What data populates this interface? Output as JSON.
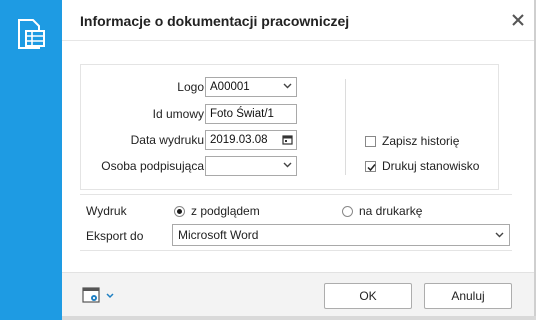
{
  "dialog": {
    "title": "Informacje o dokumentacji pracowniczej"
  },
  "colors": {
    "sidebar": "#1e9be3",
    "accent": "#1e9be3"
  },
  "icons": {
    "app": "spreadsheet-document-icon",
    "close": "close-icon",
    "settings": "window-settings-icon"
  },
  "form": {
    "logo": {
      "label": "Logo",
      "value": "A00001"
    },
    "contract": {
      "label": "Id umowy",
      "value": "Foto Świat/1"
    },
    "print_date": {
      "label": "Data wydruku",
      "value": "2019.03.08"
    },
    "signer": {
      "label": "Osoba podpisująca",
      "value": ""
    },
    "save_history": {
      "label": "Zapisz historię",
      "checked": false
    },
    "print_position": {
      "label": "Drukuj stanowisko",
      "checked": true
    }
  },
  "output": {
    "label": "Wydruk",
    "options": [
      {
        "label": "z podglądem",
        "selected": true
      },
      {
        "label": "na drukarkę",
        "selected": false
      }
    ]
  },
  "export": {
    "label": "Eksport do",
    "value": "Microsoft Word"
  },
  "footer": {
    "ok": "OK",
    "cancel": "Anuluj"
  }
}
